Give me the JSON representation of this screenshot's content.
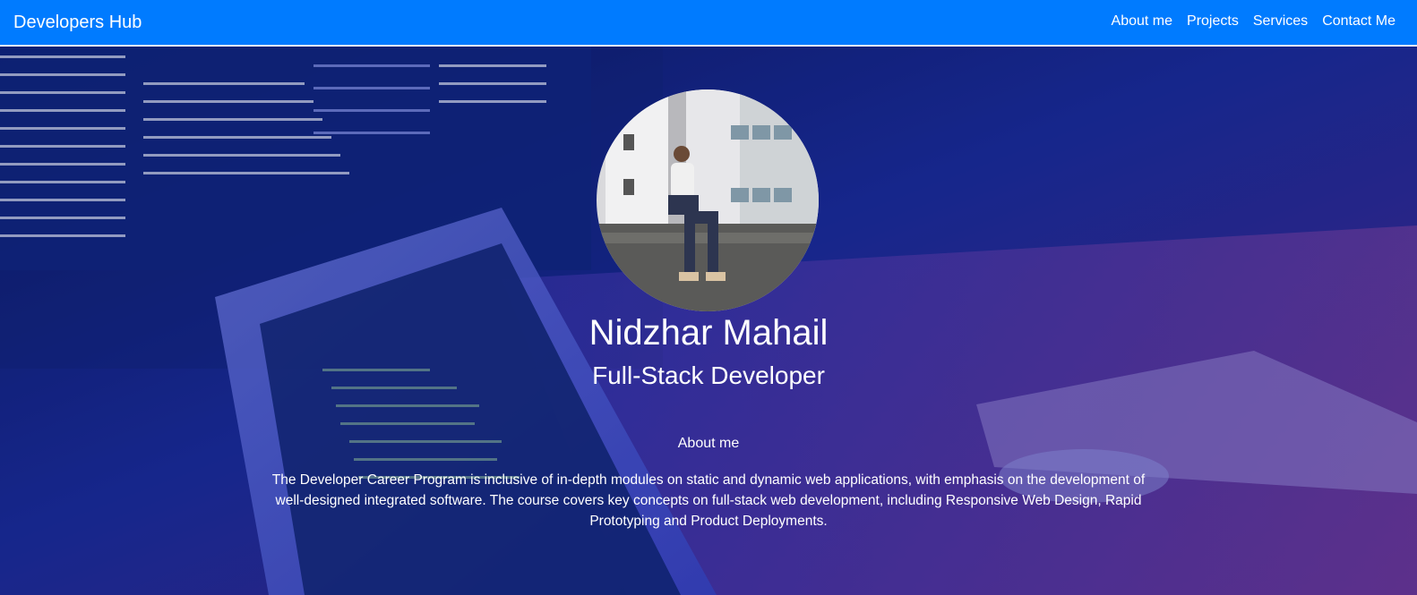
{
  "navbar": {
    "brand": "Developers Hub",
    "links": [
      "About me",
      "Projects",
      "Services",
      "Contact Me"
    ],
    "background_color": "#007bff"
  },
  "hero": {
    "name": "Nidzhar Mahail",
    "role": "Full-Stack Developer",
    "about_heading": "About me",
    "about_text": "The Developer Career Program is inclusive of in-depth modules on static and dynamic web applications, with emphasis on the development of well-designed integrated software. The course covers key concepts on full-stack web development, including Responsive Web Design, Rapid Prototyping and Product Deployments.",
    "background_overlay_color": "#1a2fd0"
  }
}
